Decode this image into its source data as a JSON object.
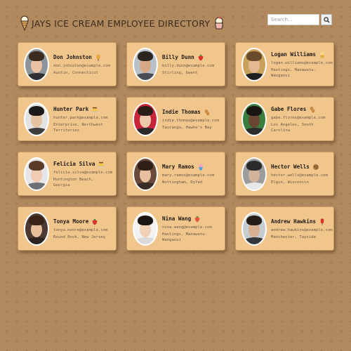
{
  "header": {
    "title": "JAYS ICE CREAM EMPLOYEE DIRECTORY",
    "left_icon": "ice-cream-cone-icon",
    "right_icon": "ice-cream-cup-icon"
  },
  "search": {
    "placeholder": "Search...",
    "value": "",
    "button_icon": "search-icon"
  },
  "colors": {
    "background": "#b08a5e",
    "card": "#f1c68d",
    "title_text": "#3a2a1c"
  },
  "employees": [
    {
      "name": "Don Johnston",
      "email": "don.johnston@example.com",
      "location": "Austin, Connecticut",
      "flavor_icon": "ice-cream-bar-icon"
    },
    {
      "name": "Billy Dunn",
      "email": "billy.dunn@example.com",
      "location": "Stirling, Gwent",
      "flavor_icon": "strawberry-icon"
    },
    {
      "name": "Logan Williams",
      "email": "logan.williams@example.com",
      "location": "Hastings, Manawatu-Wanganui",
      "flavor_icon": "sundae-icon"
    },
    {
      "name": "Hunter Park",
      "email": "hunter.park@example.com",
      "location": "Enterprise, Northwest Territories",
      "flavor_icon": "custard-icon"
    },
    {
      "name": "Indie Thomas",
      "email": "indie.thomas@example.com",
      "location": "Tauranga, Hawke's Bay",
      "flavor_icon": "peanut-icon"
    },
    {
      "name": "Gabe Flores",
      "email": "gabe.flores@example.com",
      "location": "Los Angeles, South Carolina",
      "flavor_icon": "peanut-icon"
    },
    {
      "name": "Felicia Silva",
      "email": "felicia.silva@example.com",
      "location": "Huntington Beach, Georgia",
      "flavor_icon": "custard-icon"
    },
    {
      "name": "Mary Ramos",
      "email": "mary.ramos@example.com",
      "location": "Nottingham, Dyfed",
      "flavor_icon": "ice-cream-cup-icon"
    },
    {
      "name": "Hector Wells",
      "email": "hector.wells@example.com",
      "location": "Elgin, Wisconsin",
      "flavor_icon": "cookie-icon"
    },
    {
      "name": "Tonya Moore",
      "email": "tonya.moore@example.com",
      "location": "Round Rock, New Jersey",
      "flavor_icon": "strawberry-icon"
    },
    {
      "name": "Nina Wang",
      "email": "nina.wang@example.com",
      "location": "Hastings, Manawatu-Wanganui",
      "flavor_icon": "strawberry-icon"
    },
    {
      "name": "Andrew Hawkins",
      "email": "andrew.hawkins@example.com",
      "location": "Manchester, Tayside",
      "flavor_icon": "ice-pop-icon"
    }
  ]
}
